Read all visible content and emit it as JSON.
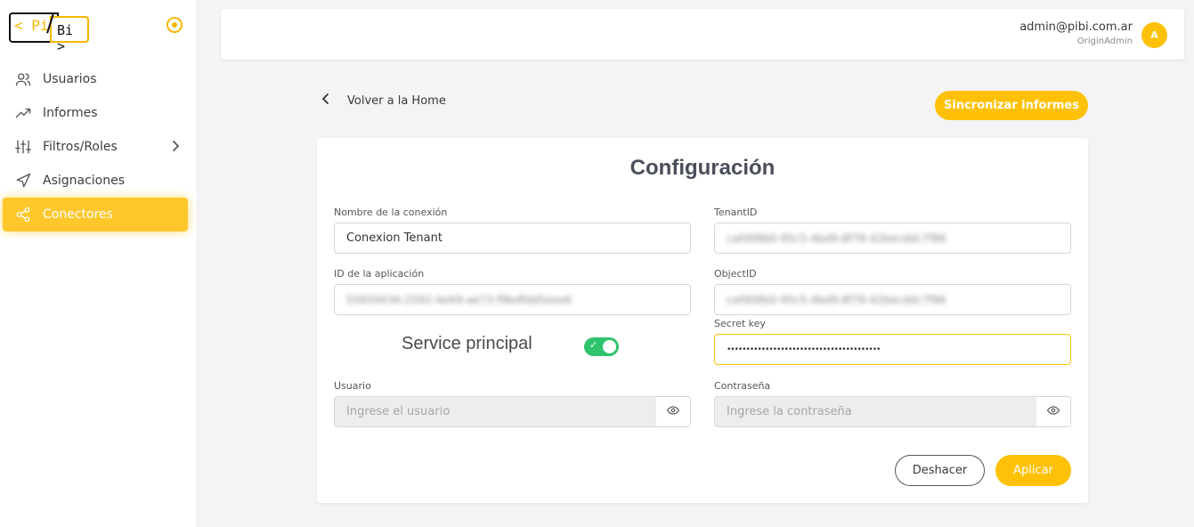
{
  "brand": {
    "logo_left": "< Pi",
    "logo_slash": "/",
    "logo_right": "Bi >",
    "accent_color": "#ffc107"
  },
  "sidebar": {
    "items": [
      {
        "label": "Usuarios",
        "icon": "users-icon",
        "active": false
      },
      {
        "label": "Informes",
        "icon": "trending-up-icon",
        "active": false
      },
      {
        "label": "Filtros/Roles",
        "icon": "sliders-icon",
        "active": false,
        "has_submenu": true
      },
      {
        "label": "Asignaciones",
        "icon": "send-icon",
        "active": false
      },
      {
        "label": "Conectores",
        "icon": "share-icon",
        "active": true
      }
    ]
  },
  "header": {
    "email": "admin@pibi.com.ar",
    "role": "OriginAdmin",
    "avatar_initial": "A"
  },
  "toolbar": {
    "back_label": "Volver a la Home",
    "sync_label": "Sincronizar informes"
  },
  "form": {
    "title": "Configuración",
    "connection_name": {
      "label": "Nombre de la conexión",
      "value": "Conexion Tenant"
    },
    "tenant_id": {
      "label": "TenantID",
      "value": "cafd08b0-95c5-4bd9-8f78-42becddc7f86"
    },
    "app_id": {
      "label": "ID de la aplicación",
      "value": "55659436-2592-4e69-ae73-f9bdfdd5eee6"
    },
    "object_id": {
      "label": "ObjectID",
      "value": "cafd08b0-95c5-4bd9-8f78-42becddc7f86"
    },
    "secret_key": {
      "label": "Secret key",
      "value": "••••••••••••••••••••••••••••••••••••••••"
    },
    "service_principal": {
      "label": "Service principal",
      "enabled": true
    },
    "user": {
      "label": "Usuario",
      "placeholder": "Ingrese el usuario"
    },
    "password": {
      "label": "Contraseña",
      "placeholder": "Ingrese la contraseña"
    },
    "undo_label": "Deshacer",
    "apply_label": "Aplicar"
  }
}
